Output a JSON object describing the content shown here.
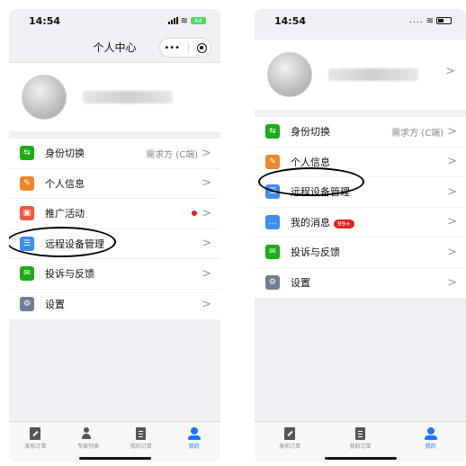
{
  "left": {
    "status_time": "14:54",
    "battery": "64",
    "nav_title": "个人中心",
    "capsule_more": "•••",
    "menu": [
      {
        "label": "身份切换",
        "value": "需求方 (C端)",
        "icon": "switch-icon",
        "color": "#1aad19"
      },
      {
        "label": "个人信息",
        "value": "",
        "icon": "edit-doc-icon",
        "color": "#f0862c"
      },
      {
        "label": "推广活动",
        "value": "",
        "icon": "gift-icon",
        "color": "#f05a3e",
        "red_dot": true
      },
      {
        "label": "远程设备管理",
        "value": "",
        "icon": "device-icon",
        "color": "#3d8cf0"
      },
      {
        "label": "投诉与反馈",
        "value": "",
        "icon": "mail-icon",
        "color": "#1aad19"
      },
      {
        "label": "设置",
        "value": "",
        "icon": "gear-icon",
        "color": "#6f7f96"
      }
    ],
    "tabs": [
      {
        "label": "发布订单",
        "icon": "publish-icon"
      },
      {
        "label": "专家列表",
        "icon": "expert-list-icon"
      },
      {
        "label": "我的订单",
        "icon": "orders-icon"
      },
      {
        "label": "我的",
        "icon": "me-icon",
        "active": true
      }
    ]
  },
  "right": {
    "status_time": "14:54",
    "signal": "....",
    "menu": [
      {
        "label": "身份切换",
        "value": "需求方 (C端)",
        "icon": "switch-icon",
        "color": "#1aad19"
      },
      {
        "label": "个人信息",
        "value": "",
        "icon": "edit-doc-icon",
        "color": "#f0862c"
      },
      {
        "label": "远程设备管理",
        "value": "",
        "icon": "device-icon",
        "color": "#3d8cf0"
      },
      {
        "label": "我的消息",
        "value": "",
        "icon": "chat-icon",
        "color": "#3d8cf0",
        "badge": "99+"
      },
      {
        "label": "投诉与反馈",
        "value": "",
        "icon": "mail-icon",
        "color": "#1aad19"
      },
      {
        "label": "设置",
        "value": "",
        "icon": "gear-icon",
        "color": "#6f7f96"
      }
    ],
    "tabs": [
      {
        "label": "发布订单",
        "icon": "publish-icon"
      },
      {
        "label": "我的订单",
        "icon": "orders-icon"
      },
      {
        "label": "我的",
        "icon": "me-icon",
        "active": true
      }
    ]
  }
}
